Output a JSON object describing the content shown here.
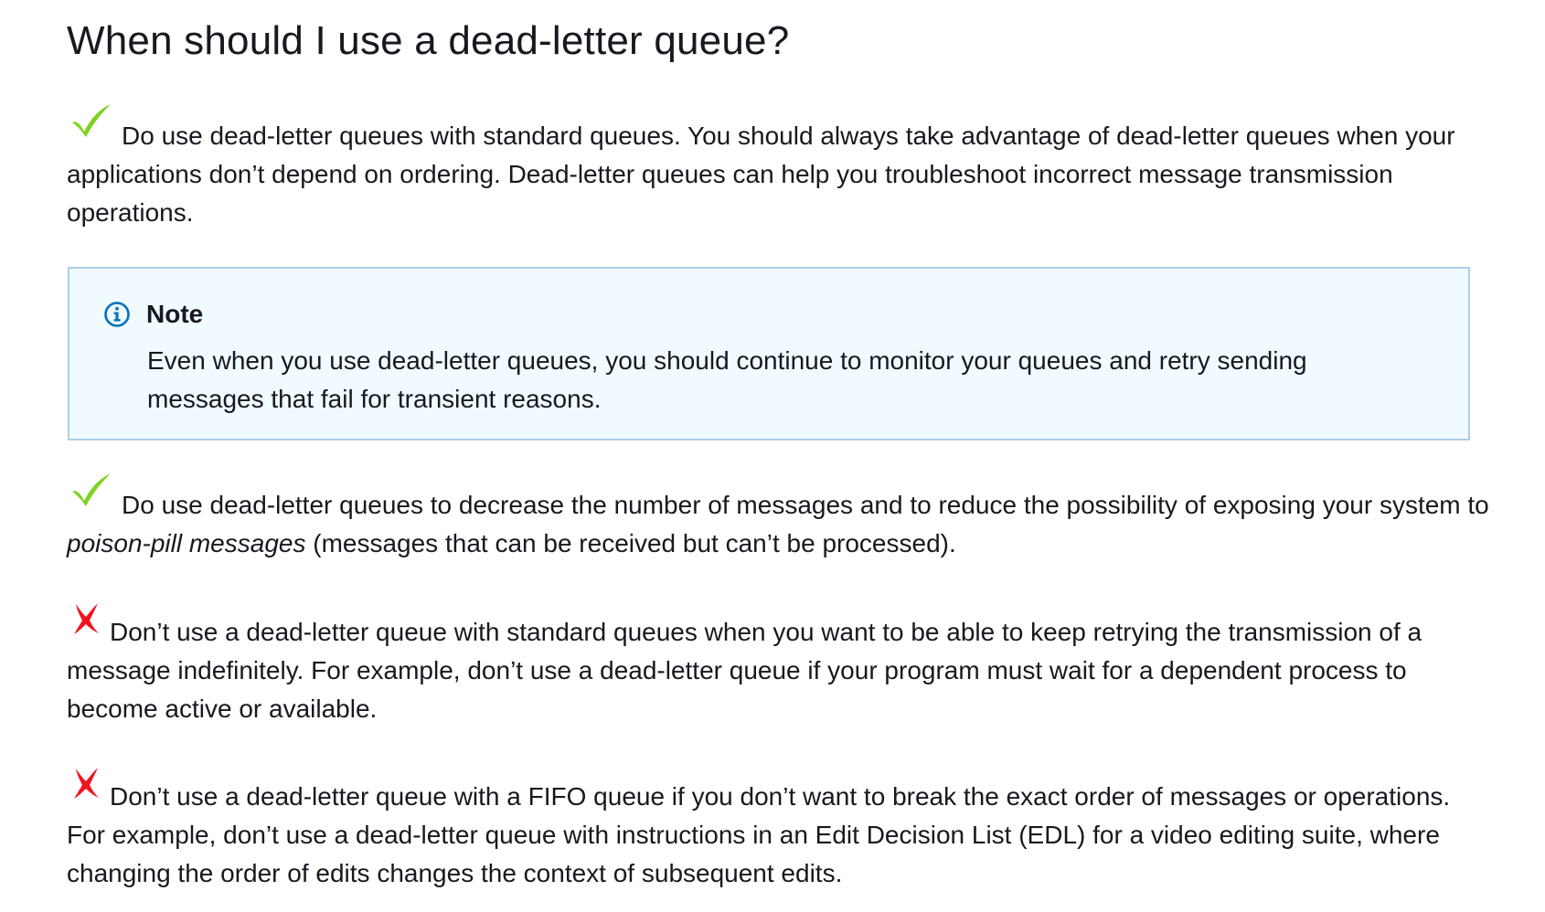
{
  "heading": "When should I use a dead-letter queue?",
  "items": [
    {
      "kind": "do",
      "icon": "check-icon",
      "text": "Do use dead-letter queues with standard queues. You should always take advantage of dead-letter queues when your applications don’t depend on ordering. Dead-letter queues can help you troubleshoot incorrect message transmission operations."
    },
    {
      "kind": "do",
      "icon": "check-icon",
      "text_before": "Do use dead-letter queues to decrease the number of messages and to reduce the possibility of exposing your system to ",
      "emphasis": "poison-pill messages",
      "text_after": " (messages that can be received but can’t be processed)."
    },
    {
      "kind": "dont",
      "icon": "cross-icon",
      "text": "Don’t use a dead-letter queue with standard queues when you want to be able to keep retrying the transmission of a message indefinitely. For example, don’t use a dead-letter queue if your program must wait for a dependent process to become active or available."
    },
    {
      "kind": "dont",
      "icon": "cross-icon",
      "text": "Don’t use a dead-letter queue with a FIFO queue if you don’t want to break the exact order of messages or operations. For example, don’t use a dead-letter queue with instructions in an Edit Decision List (EDL) for a video editing suite, where changing the order of edits changes the context of subsequent edits."
    }
  ],
  "note": {
    "icon": "info-icon",
    "title": "Note",
    "body": "Even when you use dead-letter queues, you should continue to monitor your queues and retry sending messages that fail for transient reasons."
  },
  "colors": {
    "check": "#7ed321",
    "cross": "#f0141e",
    "note_background": "#f1faff",
    "note_border": "#a9cfe8",
    "info_icon": "#0073bb",
    "text": "#16191f"
  }
}
